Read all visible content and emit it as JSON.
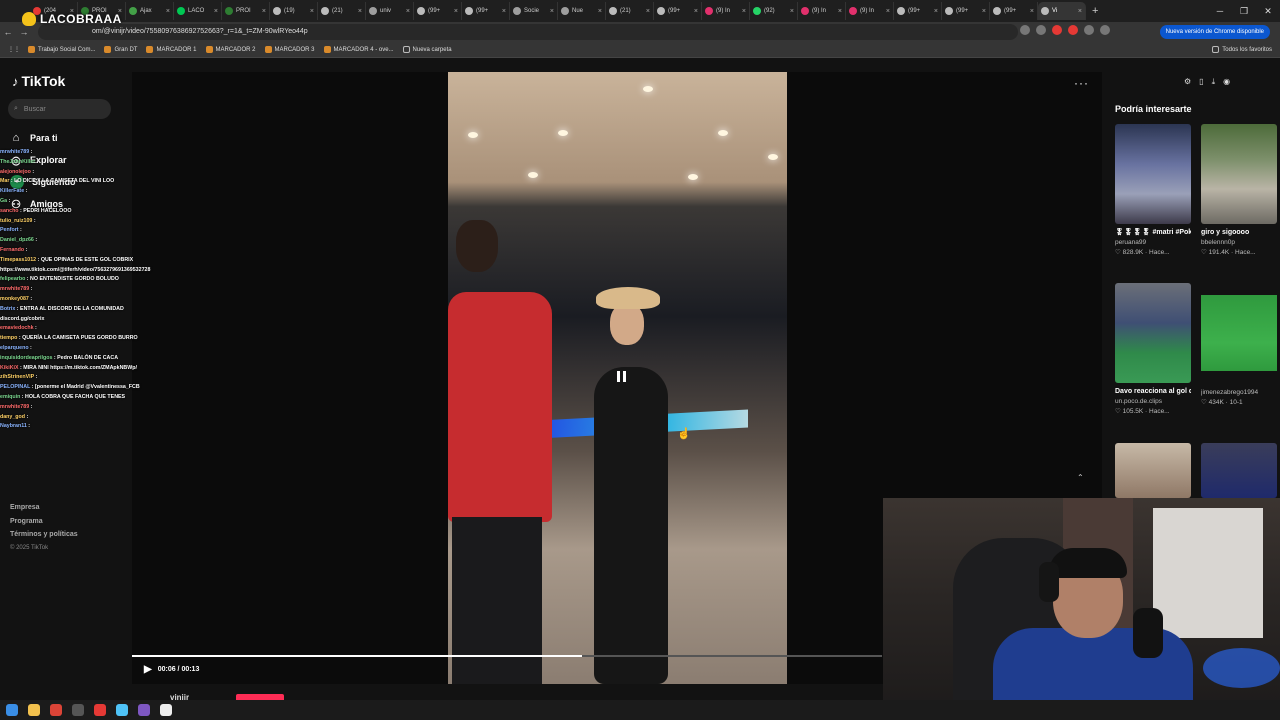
{
  "stream_logo": "LACOBRAAA",
  "browser": {
    "tabs": [
      {
        "label": "(204",
        "color": "#e53935"
      },
      {
        "label": "PROI",
        "color": "#2e7d32"
      },
      {
        "label": "Ajax",
        "color": "#43a047"
      },
      {
        "label": "LACO",
        "color": "#00c853"
      },
      {
        "label": "PROI",
        "color": "#2e7d32"
      },
      {
        "label": "(19)",
        "color": "#bbbbbb"
      },
      {
        "label": "(21)",
        "color": "#bbbbbb"
      },
      {
        "label": "univ",
        "color": "#9e9e9e"
      },
      {
        "label": "(99+",
        "color": "#bbbbbb"
      },
      {
        "label": "(99+",
        "color": "#bbbbbb"
      },
      {
        "label": "Socie",
        "color": "#9e9e9e"
      },
      {
        "label": "Nue",
        "color": "#9e9e9e"
      },
      {
        "label": "(21)",
        "color": "#bbbbbb"
      },
      {
        "label": "(99+",
        "color": "#bbbbbb"
      },
      {
        "label": "(9) In",
        "color": "#e1306c"
      },
      {
        "label": "(92)",
        "color": "#25d366"
      },
      {
        "label": "(9) In",
        "color": "#e1306c"
      },
      {
        "label": "(9) In",
        "color": "#e1306c"
      },
      {
        "label": "(99+",
        "color": "#bbbbbb"
      },
      {
        "label": "(99+",
        "color": "#bbbbbb"
      },
      {
        "label": "(99+",
        "color": "#bbbbbb"
      },
      {
        "label": "Vi",
        "color": "#bbbbbb"
      }
    ],
    "url": "om/@vinijr/video/7558097638692752663?_r=1&_t=ZM-90wlRYeo44p",
    "update_label": "Nueva versión de Chrome disponible",
    "bookmarks": [
      "Trabajo Social Com...",
      "Gran DT",
      "MARCADOR 1",
      "MARCADOR 2",
      "MARCADOR 3",
      "MARCADOR 4 - ove...",
      "Nueva carpeta"
    ],
    "all_bookmarks": "Todos los favoritos"
  },
  "tiktok": {
    "logo": "TikTok",
    "search_placeholder": "Buscar",
    "nav": [
      "Para ti",
      "Explorar",
      "Siguiendo",
      "Amigos"
    ],
    "footer": [
      "Empresa",
      "Programa",
      "Términos y políticas"
    ],
    "copyright": "© 2025 TikTok",
    "more": "···",
    "time": "00:06 / 00:13",
    "progress_fraction": 0.6,
    "author_stub": "vinijr"
  },
  "chat": [
    {
      "user": "mrwhite789",
      "msg": ""
    },
    {
      "user": "TheJohnKiller",
      "msg": ""
    },
    {
      "user": "alejonolejoo",
      "msg": ""
    },
    {
      "user": "Mar",
      "msg": "LO DICE X LA CAMISETA DEL VINI LOO"
    },
    {
      "user": "KillerFate",
      "msg": ""
    },
    {
      "user": "Ga",
      "msg": ""
    },
    {
      "user": "sancho",
      "msg": "PEDRI HACELOOO"
    },
    {
      "user": "tulio_ruiz109",
      "msg": ""
    },
    {
      "user": "Penfort",
      "msg": ""
    },
    {
      "user": "Daniel_dpz66",
      "msg": ""
    },
    {
      "user": "Fernando",
      "msg": ""
    },
    {
      "user": "Timepass1012",
      "msg": "QUE OPINAS DE ESTE GOL COBRIX"
    },
    {
      "user": "",
      "msg": "https://www.tiktok.com/@tiferh/video/7563279691369532728"
    },
    {
      "user": "felipearbo",
      "msg": "NO ENTENDISTE GORDO BOLUDO"
    },
    {
      "user": "mrwhite789",
      "msg": ""
    },
    {
      "user": "monkey087",
      "msg": ""
    },
    {
      "user": "Botrix",
      "msg": "ENTRA AL DISCORD DE LA COMUNIDAD"
    },
    {
      "user": "",
      "msg": "discord.gg/cobrix"
    },
    {
      "user": "emaviedochk",
      "msg": ""
    },
    {
      "user": "tiempo",
      "msg": "QUERÍA LA CAMISETA PUES GORDO BURRO"
    },
    {
      "user": "elparqueno",
      "msg": ""
    },
    {
      "user": "inquisidordeaprilgos",
      "msg": "Pedro BALÓN DE CACA"
    },
    {
      "user": "KikiKiX",
      "msg": "MIRA NINI https://m.tiktok.com/ZMApkNBWp/"
    },
    {
      "user": "zihStrinenVIP",
      "msg": ""
    },
    {
      "user": "PELOPINAL",
      "msg": "[ponerme el Madrid @Vvalentinessa_FCB"
    },
    {
      "user": "emiquin",
      "msg": "HOLA COBRA QUE FACHA QUE TENES"
    },
    {
      "user": "mrwhite789",
      "msg": ""
    },
    {
      "user": "dany_god",
      "msg": ""
    },
    {
      "user": "Naybran11",
      "msg": ""
    }
  ],
  "right_panel": {
    "title": "Podría interesarte",
    "recs": [
      {
        "caption": "🎖🎖🎖🎖 #matri #Pokemon...",
        "user": "peruana99",
        "stats": "♡ 828.9K · Hace..."
      },
      {
        "caption": "giro y sigoooo",
        "user": "bbelennn0p",
        "stats": "♡ 191.4K · Hace..."
      },
      {
        "caption": "Davo reacciona al gol de Bellingham ...",
        "user": "un.poco.de.clips",
        "stats": "♡ 105.5K · Hace..."
      },
      {
        "caption": "",
        "user": "jimenezabrego1994",
        "stats": "♡ 434K · 10-1"
      }
    ]
  }
}
